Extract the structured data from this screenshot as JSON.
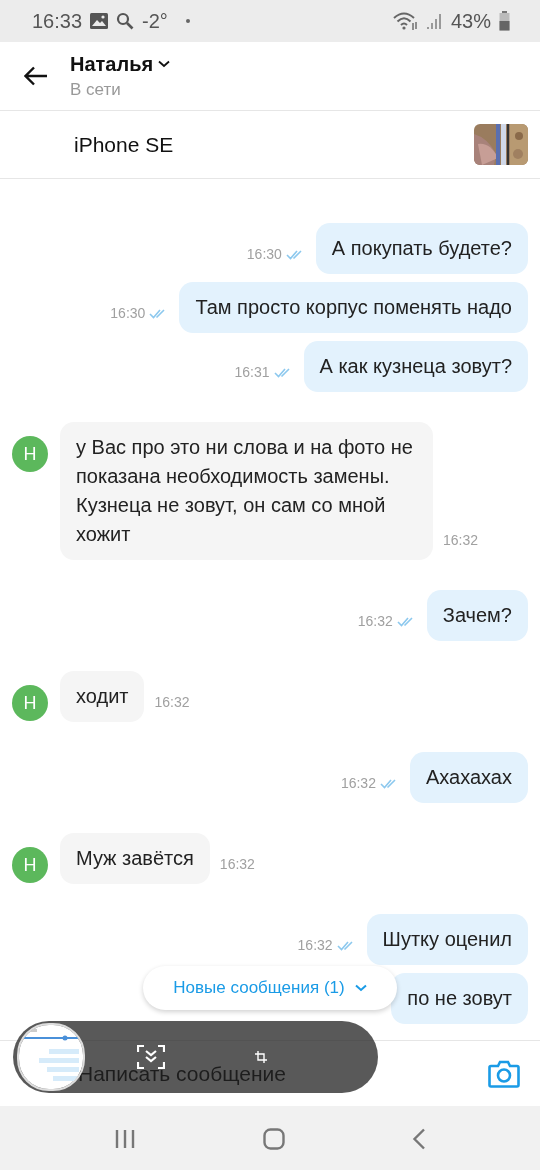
{
  "status_bar": {
    "time": "16:33",
    "temperature": "-2°",
    "battery": "43%"
  },
  "header": {
    "name": "Наталья",
    "status": "В сети"
  },
  "listing": {
    "title": "iPhone SE"
  },
  "messages": [
    {
      "kind": "out",
      "text": "А покупать будете?",
      "time": "16:30"
    },
    {
      "kind": "out",
      "text": "Там просто корпус поменять надо",
      "time": "16:30"
    },
    {
      "kind": "out",
      "text": "А как кузнеца зовут?",
      "time": "16:31"
    },
    {
      "kind": "in",
      "avatar": "Н",
      "text": "у Вас про это ни слова и на фото не показана необходимость замены. Кузнеца не зовут, он сам со мной хожит",
      "time": "16:32"
    },
    {
      "kind": "out",
      "text": "Зачем?",
      "time": "16:32"
    },
    {
      "kind": "in",
      "avatar": "Н",
      "text": "ходит",
      "time": "16:32"
    },
    {
      "kind": "out",
      "text": "Ахахахах",
      "time": "16:32"
    },
    {
      "kind": "in",
      "avatar": "Н",
      "text": "Муж завётся",
      "time": "16:32"
    },
    {
      "kind": "out",
      "text": "Шутку оценил",
      "time": "16:32"
    },
    {
      "kind": "out",
      "text": "по не зовут"
    }
  ],
  "new_messages_button": "Новые сообщения (1)",
  "input": {
    "placeholder": "Написать сообщение"
  }
}
